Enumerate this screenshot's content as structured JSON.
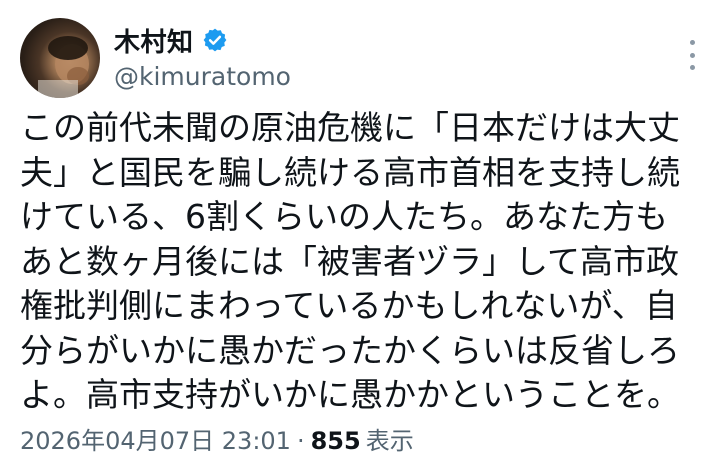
{
  "author": {
    "display_name": "木村知",
    "handle": "@kimuratomo",
    "verified": true,
    "verified_badge_color": "#1d9bf0"
  },
  "tweet": {
    "text": "この前代未聞の原油危機に「日本だけは大丈\n夫」と国民を騙し続ける高市首相を支持し続\nけている、6割くらいの人たち。あなた方も\nあと数ヶ月後には「被害者ヅラ」して高市政\n権批判側にまわっているかもしれないが、自\n分らがいかに愚かだったかくらいは反省しろ\nよ。高市支持がいかに愚かかということを。"
  },
  "meta": {
    "timestamp": "2026年04月07日 23:01",
    "separator": "·",
    "views_count": "855",
    "views_label": "表示"
  },
  "icons": {
    "more": "more-vertical-icon",
    "verified": "verified-badge-icon"
  }
}
